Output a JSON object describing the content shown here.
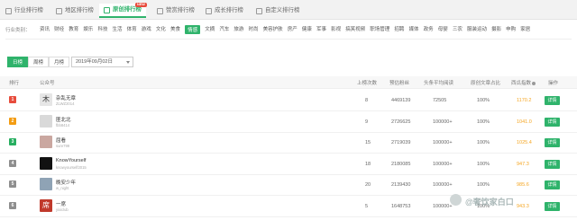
{
  "tabs": [
    {
      "label": "行业排行榜"
    },
    {
      "label": "地区排行榜"
    },
    {
      "label": "原创排行榜",
      "badge": "NEW"
    },
    {
      "label": "赞赏排行榜"
    },
    {
      "label": "成长排行榜"
    },
    {
      "label": "自定义排行榜"
    }
  ],
  "industry": {
    "label": "行业类别：",
    "items": [
      "资讯",
      "财经",
      "教育",
      "娱乐",
      "科技",
      "生活",
      "体育",
      "游戏",
      "文化",
      "美食",
      "情感",
      "文摘",
      "汽车",
      "旅游",
      "时尚",
      "美容护肤",
      "房产",
      "健康",
      "军事",
      "影视",
      "搞笑视频",
      "职场管理",
      "招聘",
      "媒体",
      "政务",
      "母婴",
      "三农",
      "服装运动",
      "摄影",
      "申购",
      "家居"
    ],
    "active": "情感"
  },
  "period": {
    "day": "日榜",
    "week": "周榜",
    "month": "月榜",
    "date": "2019年09月02日"
  },
  "table": {
    "headers": {
      "rank": "排行",
      "account": "公众号",
      "posts": "上榜次数",
      "avg_score": "预估粉丝",
      "reads": "头条平均阅读",
      "original": "原创文章占比",
      "index": "西瓜指数",
      "action": "操作"
    },
    "rows": [
      {
        "rank": "1",
        "rank_color": "#e74c3c",
        "name": "杂乱无章",
        "account": "ZLWZ2014",
        "posts": "8",
        "fans": "4469139",
        "reads": "72505",
        "original": "100%",
        "index": "1170.2",
        "action": "详情",
        "avatar_color": "#e6e6e6",
        "avatar_text": "木"
      },
      {
        "rank": "2",
        "rank_color": "#f39c12",
        "name": "匪北北",
        "account": "fbb8414",
        "posts": "9",
        "fans": "2726625",
        "reads": "100000+",
        "original": "100%",
        "index": "1041.0",
        "action": "详情",
        "avatar_color": "#d9d9d9",
        "avatar_text": ""
      },
      {
        "rank": "3",
        "rank_color": "#27ae60",
        "name": "屈看",
        "account": "sure799",
        "posts": "15",
        "fans": "2719039",
        "reads": "100000+",
        "original": "100%",
        "index": "1025.4",
        "action": "详情",
        "avatar_color": "#caa7a0",
        "avatar_text": ""
      },
      {
        "rank": "4",
        "rank_color": "#8e8e8e",
        "name": "KnowYourself",
        "account": "knowyourself2015",
        "posts": "18",
        "fans": "2180085",
        "reads": "100000+",
        "original": "100%",
        "index": "947.3",
        "action": "详情",
        "avatar_color": "#111111",
        "avatar_text": ""
      },
      {
        "rank": "5",
        "rank_color": "#8e8e8e",
        "name": "晚安少年",
        "account": "w_night",
        "posts": "20",
        "fans": "2139430",
        "reads": "100000+",
        "original": "100%",
        "index": "985.6",
        "action": "详情",
        "avatar_color": "#8fa3b5",
        "avatar_text": ""
      },
      {
        "rank": "6",
        "rank_color": "#8e8e8e",
        "name": "一席",
        "account": "yixiclub",
        "posts": "5",
        "fans": "1648753",
        "reads": "100000+",
        "original": "100%",
        "index": "943.3",
        "action": "详情",
        "avatar_color": "#c0392b",
        "avatar_text": "席"
      }
    ]
  },
  "watermark": "@奢饮家白口",
  "colors": {
    "accent": "#2fb36b",
    "index": "#f5a623"
  }
}
